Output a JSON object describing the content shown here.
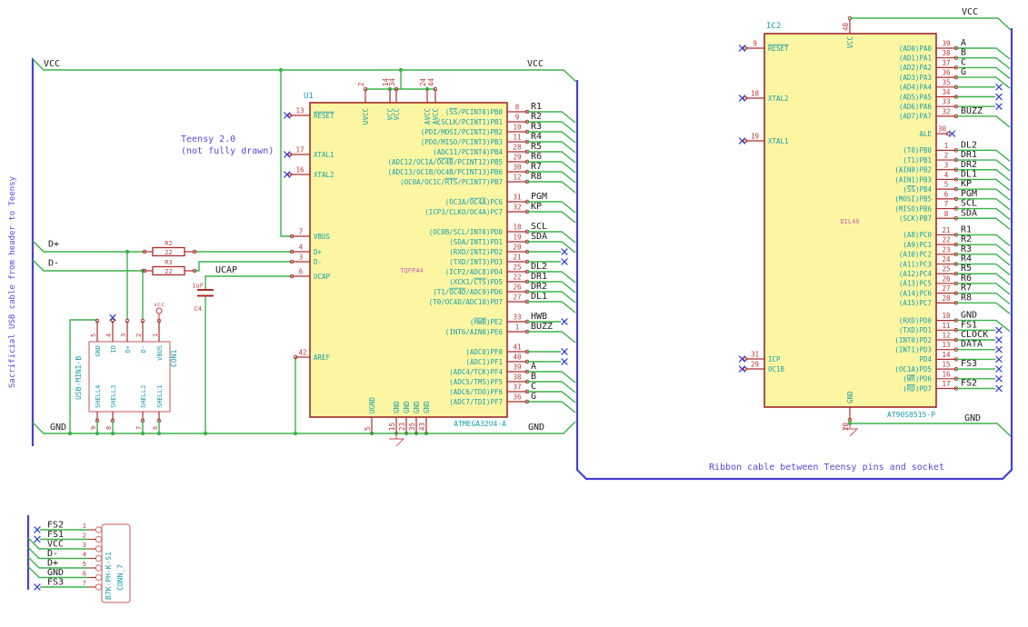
{
  "colors": {
    "wire": "#3cb24a",
    "bus": "#4840d4",
    "component_outline": "#a02727",
    "pin": "#ae2b2b",
    "pin_number": "#c13333",
    "pin_name": "#169fa8",
    "reference": "#169fa8",
    "field": "#c760aa",
    "net_label": "#1b1b1b",
    "comment": "#5a47e0",
    "symbol_fill": "#fcf6a3",
    "no_connect": "#3038d8",
    "connector_outline": "#d07c7c",
    "small_ref": "#c14747",
    "gnd_symbol": "#cf6f6f",
    "background": "#ffffff"
  },
  "comments": {
    "usb_cable_note": "Sacrificial USB cable from header to Teensy",
    "teensy_note_line1": "Teensy 2.0",
    "teensy_note_line2": "(not fully drawn)",
    "ribbon_note": "Ribbon cable between Teensy pins and socket"
  },
  "power_labels": {
    "vcc": "VCC",
    "gnd": "GND",
    "vcc_symbol": "vcc"
  },
  "net_labels": {
    "d_plus": "D+",
    "d_minus": "D-",
    "ucap": "UCAP"
  },
  "u1": {
    "reference": "U1",
    "value": "ATMEGA32U4-A",
    "package": "TQFP44",
    "left_pins": [
      {
        "num": "13",
        "name": "~RESET~",
        "nc": true
      },
      {
        "num": "17",
        "name": "XTAL1",
        "nc": true
      },
      {
        "num": "16",
        "name": "XTAL2",
        "nc": true
      },
      {
        "num": "7",
        "name": "VBUS"
      },
      {
        "num": "4",
        "name": "D+"
      },
      {
        "num": "3",
        "name": "D-"
      },
      {
        "num": "6",
        "name": "UCAP"
      },
      {
        "num": "42",
        "name": "AREF"
      }
    ],
    "top_pins": [
      {
        "num": "2",
        "name": "UVCC"
      },
      {
        "num": "14",
        "name": "VCC"
      },
      {
        "num": "34",
        "name": "VCC"
      },
      {
        "num": "24",
        "name": "AVCC"
      },
      {
        "num": "44",
        "name": "AVCC"
      }
    ],
    "bottom_pins": [
      {
        "num": "5",
        "name": "UGND"
      },
      {
        "num": "15",
        "name": "GND"
      },
      {
        "num": "23",
        "name": "GND"
      },
      {
        "num": "35",
        "name": "GND"
      },
      {
        "num": "43",
        "name": "GND"
      }
    ],
    "right_pins": [
      {
        "num": "8",
        "name": "(~SS~/PCINT0)PB0",
        "net": "R1",
        "term": "bus"
      },
      {
        "num": "9",
        "name": "(SCLK/PCINT1)PB1",
        "net": "R2",
        "term": "bus"
      },
      {
        "num": "10",
        "name": "(PDI/MOSI/PCINT2)PB2",
        "net": "R3",
        "term": "bus"
      },
      {
        "num": "11",
        "name": "(PDO/MISO/PCINT3)PB3",
        "net": "R4",
        "term": "bus"
      },
      {
        "num": "28",
        "name": "(ADC11/PCINT4)PB4",
        "net": "R5",
        "term": "bus"
      },
      {
        "num": "29",
        "name": "(ADC12/OC1A/~OC4B~/PCINT12)PB5",
        "net": "R6",
        "term": "bus"
      },
      {
        "num": "30",
        "name": "(ADC13/OC1B/OC4B/PCINT13)PB6",
        "net": "R7",
        "term": "bus"
      },
      {
        "num": "12",
        "name": "(OC0A/OC1C/~RTS~/PCINT7)PB7",
        "net": "R8",
        "term": "bus"
      },
      {
        "num": "31",
        "name": "(OC3A/~OC4A~)PC6",
        "net": "PGM",
        "term": "bus"
      },
      {
        "num": "32",
        "name": "(ICP3/CLKO/OC4A)PC7",
        "net": "KP",
        "term": "bus"
      },
      {
        "num": "18",
        "name": "(OC0B/SCL/INT0)PD0",
        "net": "SCL",
        "term": "bus"
      },
      {
        "num": "19",
        "name": "(SDA/INT1)PD1",
        "net": "SDA",
        "term": "bus"
      },
      {
        "num": "20",
        "name": "(RXD/INT2)PD2",
        "net": "",
        "term": "nc"
      },
      {
        "num": "21",
        "name": "(TXD/INT3)PD3",
        "net": "",
        "term": "nc"
      },
      {
        "num": "25",
        "name": "(ICP2/ADC8)PD4",
        "net": "DL2",
        "term": "bus"
      },
      {
        "num": "22",
        "name": "(XCK1/~CTS~)PD5",
        "net": "DR1",
        "term": "bus"
      },
      {
        "num": "26",
        "name": "(T1/~OC4D~/ADC9)PD6",
        "net": "DR2",
        "term": "bus"
      },
      {
        "num": "27",
        "name": "(T0/OC4D/ADC10)PD7",
        "net": "DL1",
        "term": "bus"
      },
      {
        "num": "33",
        "name": "(~HWB~)PE2",
        "net": "HWB",
        "term": "nc"
      },
      {
        "num": "1",
        "name": "(INT6/AIN0)PE6",
        "net": "BUZZ",
        "term": "bus"
      },
      {
        "num": "41",
        "name": "(ADC0)PF0",
        "net": "",
        "term": "nc"
      },
      {
        "num": "40",
        "name": "(ADC1)PF1",
        "net": "",
        "term": "nc"
      },
      {
        "num": "39",
        "name": "(ADC4/TCK)PF4",
        "net": "A",
        "term": "bus"
      },
      {
        "num": "38",
        "name": "(ADC5/TMS)PF5",
        "net": "B",
        "term": "bus"
      },
      {
        "num": "37",
        "name": "(ADC6/TDO)PF6",
        "net": "C",
        "term": "bus"
      },
      {
        "num": "36",
        "name": "(ADC7/TDI)PF7",
        "net": "G",
        "term": "bus"
      }
    ]
  },
  "ic2": {
    "reference": "IC2",
    "value": "AT90S8515-P",
    "package": "DIL40",
    "left_pins": [
      {
        "num": "9",
        "name": "~RESET~",
        "nc": true
      },
      {
        "num": "18",
        "name": "XTAL2",
        "nc": true
      },
      {
        "num": "19",
        "name": "XTAL1",
        "nc": true
      },
      {
        "num": "31",
        "name": "ICP",
        "nc": true
      },
      {
        "num": "29",
        "name": "OC1B",
        "nc": true
      }
    ],
    "top_pins": [
      {
        "num": "40",
        "name": "VCC"
      }
    ],
    "bottom_pins": [
      {
        "num": "20",
        "name": "GND"
      }
    ],
    "right_pins": [
      {
        "num": "39",
        "name": "(AD0)PA0",
        "net": "A",
        "term": "bus"
      },
      {
        "num": "38",
        "name": "(AD1)PA1",
        "net": "B",
        "term": "bus"
      },
      {
        "num": "37",
        "name": "(AD2)PA2",
        "net": "C",
        "term": "bus"
      },
      {
        "num": "36",
        "name": "(AD3)PA3",
        "net": "G",
        "term": "bus"
      },
      {
        "num": "35",
        "name": "(AD4)PA4",
        "net": "",
        "term": "nc"
      },
      {
        "num": "34",
        "name": "(AD5)PA5",
        "net": "",
        "term": "nc"
      },
      {
        "num": "33",
        "name": "(AD6)PA6",
        "net": "",
        "term": "nc"
      },
      {
        "num": "32",
        "name": "(AD7)PA7",
        "net": "BUZZ",
        "term": "bus"
      },
      {
        "num": "30",
        "name": "ALE",
        "net": "",
        "term": "ncstub"
      },
      {
        "num": "1",
        "name": "(T0)PB0",
        "net": "DL2",
        "term": "bus"
      },
      {
        "num": "2",
        "name": "(T1)PB1",
        "net": "DR1",
        "term": "bus"
      },
      {
        "num": "3",
        "name": "(AIN0)PB2",
        "net": "DR2",
        "term": "bus"
      },
      {
        "num": "4",
        "name": "(AIN1)PB3",
        "net": "DL1",
        "term": "bus"
      },
      {
        "num": "5",
        "name": "(~SS~)PB4",
        "net": "KP",
        "term": "bus"
      },
      {
        "num": "6",
        "name": "(MOSI)PB5",
        "net": "PGM",
        "term": "bus"
      },
      {
        "num": "7",
        "name": "(MISO)PB6",
        "net": "SCL",
        "term": "bus"
      },
      {
        "num": "8",
        "name": "(SCK)PB7",
        "net": "SDA",
        "term": "bus"
      },
      {
        "num": "21",
        "name": "(A8)PC0",
        "net": "R1",
        "term": "bus"
      },
      {
        "num": "22",
        "name": "(A9)PC1",
        "net": "R2",
        "term": "bus"
      },
      {
        "num": "23",
        "name": "(A10)PC2",
        "net": "R3",
        "term": "bus"
      },
      {
        "num": "24",
        "name": "(A11)PC3",
        "net": "R4",
        "term": "bus"
      },
      {
        "num": "25",
        "name": "(A12)PC4",
        "net": "R5",
        "term": "bus"
      },
      {
        "num": "26",
        "name": "(A13)PC5",
        "net": "R6",
        "term": "bus"
      },
      {
        "num": "27",
        "name": "(A14)PC6",
        "net": "R7",
        "term": "bus"
      },
      {
        "num": "28",
        "name": "(A15)PC7",
        "net": "R8",
        "term": "bus"
      },
      {
        "num": "10",
        "name": "(RXD)PD0",
        "net": "GND",
        "term": "bus"
      },
      {
        "num": "11",
        "name": "(TXD)PD1",
        "net": "FS1",
        "term": "nc"
      },
      {
        "num": "12",
        "name": "(INT0)PD2",
        "net": "CLOCK",
        "term": "nc"
      },
      {
        "num": "13",
        "name": "(INT1)PD3",
        "net": "DATA",
        "term": "nc"
      },
      {
        "num": "14",
        "name": "PD4",
        "net": "",
        "term": "nc"
      },
      {
        "num": "15",
        "name": "(OC1A)PD5",
        "net": "FS3",
        "term": "nc"
      },
      {
        "num": "16",
        "name": "(~WR~)PD6",
        "net": "",
        "term": "nc"
      },
      {
        "num": "17",
        "name": "(~RD~)PD7",
        "net": "FS2",
        "term": "nc"
      }
    ]
  },
  "r2": {
    "reference": "R2",
    "value": "22"
  },
  "r3": {
    "reference": "R3",
    "value": "22"
  },
  "c4": {
    "reference": "C4",
    "value": "1uF"
  },
  "con1": {
    "reference": "CON1",
    "value": "USB-MINI-B",
    "top_pins": [
      {
        "num": "5",
        "name": "GND"
      },
      {
        "num": "4",
        "name": "ID",
        "nc": true
      },
      {
        "num": "3",
        "name": "D+"
      },
      {
        "num": "2",
        "name": "D-"
      },
      {
        "num": "1",
        "name": "VBUS"
      }
    ],
    "bottom_pins": [
      {
        "num": "9",
        "name": "SHELL4"
      },
      {
        "num": "8",
        "name": "SHELL3"
      },
      {
        "num": "7",
        "name": "SHELL2"
      },
      {
        "num": "6",
        "name": "SHELL1"
      }
    ]
  },
  "conn7": {
    "reference": "CONN_7",
    "value": "B7K-PH-K-S1",
    "pins": [
      {
        "num": "1",
        "net": "FS2",
        "term": "nc"
      },
      {
        "num": "2",
        "net": "FS1",
        "term": "nc"
      },
      {
        "num": "3",
        "net": "VCC",
        "term": "bus"
      },
      {
        "num": "4",
        "net": "D-",
        "term": "bus"
      },
      {
        "num": "5",
        "net": "D+",
        "term": "bus"
      },
      {
        "num": "6",
        "net": "GND",
        "term": "bus"
      },
      {
        "num": "7",
        "net": "FS3",
        "term": "nc"
      }
    ]
  }
}
